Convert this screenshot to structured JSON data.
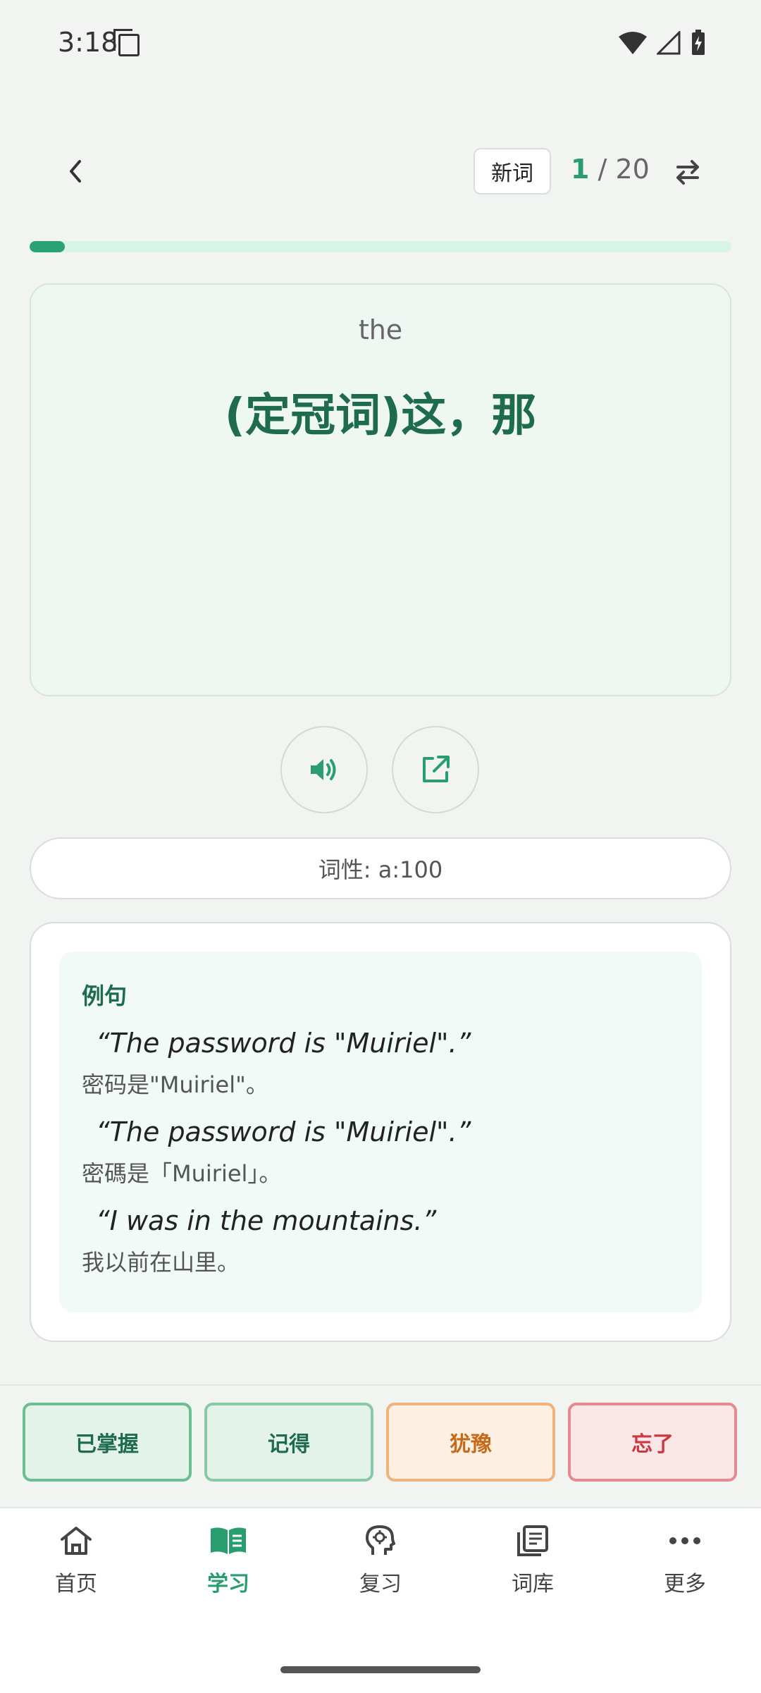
{
  "status_bar": {
    "time": "3:18"
  },
  "header": {
    "badge": "新词",
    "counter_current": "1",
    "counter_separator": "/",
    "counter_total": "20"
  },
  "progress": {
    "fraction": 0.05
  },
  "card": {
    "word": "the",
    "meaning": "(定冠词)这，那"
  },
  "pos": "词性: a:100",
  "examples": {
    "title": "例句",
    "items": [
      {
        "en": "“The password is \"Muiriel\".”",
        "zh": "密码是\"Muiriel\"。"
      },
      {
        "en": "“The password is \"Muiriel\".”",
        "zh": "密碼是「Muiriel」。"
      },
      {
        "en": "“I was in the mountains.”",
        "zh": "我以前在山里。"
      }
    ]
  },
  "actions": {
    "mastered": "已掌握",
    "remember": "记得",
    "hesitate": "犹豫",
    "forgot": "忘了"
  },
  "nav": [
    {
      "label": "首页",
      "icon": "home-icon"
    },
    {
      "label": "学习",
      "icon": "book-icon",
      "active": true
    },
    {
      "label": "复习",
      "icon": "brain-icon"
    },
    {
      "label": "词库",
      "icon": "library-icon"
    },
    {
      "label": "更多",
      "icon": "more-icon"
    }
  ],
  "colors": {
    "accent": "#2a9d70",
    "accent_dark": "#1f6b4e",
    "progress_track": "#d6f5e6",
    "hesitate": "#c66a1a",
    "forgot": "#c9393f"
  }
}
